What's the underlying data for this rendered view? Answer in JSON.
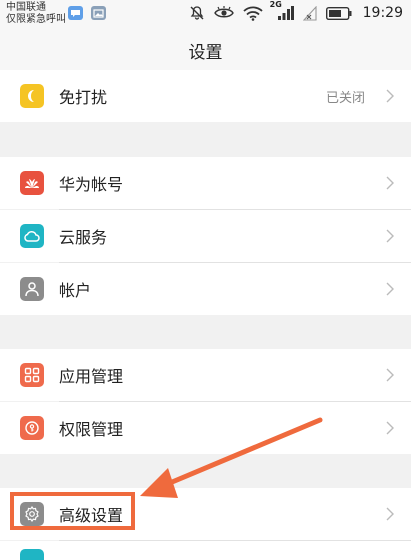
{
  "status_bar": {
    "carrier_line1": "中国联通",
    "carrier_line2": "仅限紧急呼叫",
    "network_type": "2G",
    "time": "19:29"
  },
  "header": {
    "title": "设置"
  },
  "settings": {
    "do_not_disturb": {
      "label": "免打扰",
      "value": "已关闭",
      "icon": "moon-icon",
      "color": "#f5c424"
    },
    "huawei_account": {
      "label": "华为帐号",
      "icon": "huawei-logo-icon",
      "color": "#e8523f"
    },
    "cloud_service": {
      "label": "云服务",
      "icon": "cloud-icon",
      "color": "#1fb5c4"
    },
    "accounts": {
      "label": "帐户",
      "icon": "user-icon",
      "color": "#8c8c8c"
    },
    "app_management": {
      "label": "应用管理",
      "icon": "grid-icon",
      "color": "#ef6a4c"
    },
    "permission_management": {
      "label": "权限管理",
      "icon": "key-icon",
      "color": "#ef6a4c"
    },
    "advanced_settings": {
      "label": "高级设置",
      "icon": "gear-icon",
      "color": "#8c8c8c"
    }
  },
  "annotation": {
    "color": "#ef6a3d"
  }
}
